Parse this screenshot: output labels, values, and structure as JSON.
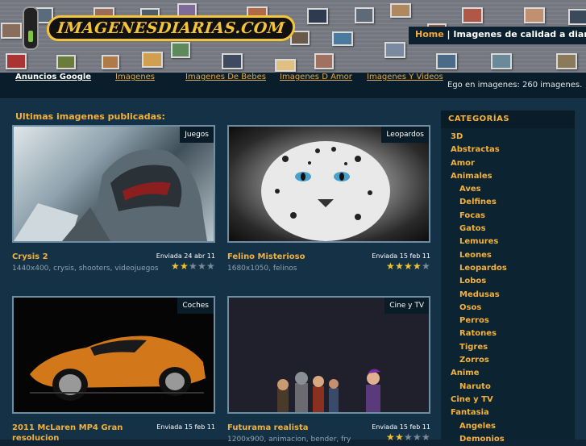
{
  "header": {
    "logo_text": "IMAGENESDIARIAS.COM",
    "nav_home": "Home",
    "nav_sep": " | ",
    "nav_tagline": "Imagenes de calidad a diario"
  },
  "navbar": {
    "links": [
      "Anuncios Google",
      "Imagenes",
      "Imagenes De Bebes",
      "Imagenes D Amor",
      "Imagenes Y Videos"
    ],
    "count_text": "Ego en imagenes: 260 imagenes."
  },
  "main": {
    "latest_title": "Ultimas imagenes publicadas:",
    "cards": [
      {
        "badge": "Juegos",
        "title": "Crysis 2",
        "date": "Enviada 24 abr 11",
        "meta": "1440x400, crysis, shooters, videojuegos",
        "rating": 2
      },
      {
        "badge": "Leopardos",
        "title": "Felino Misterioso",
        "date": "Enviada 15 feb 11",
        "meta": "1680x1050, felinos",
        "rating": 4
      },
      {
        "badge": "Coches",
        "title": "2011 McLaren MP4 Gran resolucion",
        "date": "Enviada 15 feb 11",
        "meta": "",
        "rating": 0
      },
      {
        "badge": "Cine y TV",
        "title": "Futurama realista",
        "date": "Enviada 15 feb 11",
        "meta": "1200x900, animacion, bender, fry",
        "rating": 2
      }
    ]
  },
  "sidebar": {
    "title": "CATEGORÍAS",
    "categories": [
      {
        "label": "3D",
        "level": "top"
      },
      {
        "label": "Abstractas",
        "level": "top"
      },
      {
        "label": "Amor",
        "level": "top"
      },
      {
        "label": "Animales",
        "level": "top"
      },
      {
        "label": "Aves",
        "level": "sub"
      },
      {
        "label": "Delfines",
        "level": "sub"
      },
      {
        "label": "Focas",
        "level": "sub"
      },
      {
        "label": "Gatos",
        "level": "sub"
      },
      {
        "label": "Lemures",
        "level": "sub"
      },
      {
        "label": "Leones",
        "level": "sub"
      },
      {
        "label": "Leopardos",
        "level": "sub"
      },
      {
        "label": "Lobos",
        "level": "sub"
      },
      {
        "label": "Medusas",
        "level": "sub"
      },
      {
        "label": "Osos",
        "level": "sub"
      },
      {
        "label": "Perros",
        "level": "sub"
      },
      {
        "label": "Ratones",
        "level": "sub"
      },
      {
        "label": "Tigres",
        "level": "sub"
      },
      {
        "label": "Zorros",
        "level": "sub"
      },
      {
        "label": "Anime",
        "level": "top"
      },
      {
        "label": "Naruto",
        "level": "sub"
      },
      {
        "label": "Cine y TV",
        "level": "top"
      },
      {
        "label": "Fantasia",
        "level": "top"
      },
      {
        "label": "Angeles",
        "level": "sub"
      },
      {
        "label": "Demonios",
        "level": "sub"
      }
    ]
  },
  "colors": {
    "accent": "#f4b13a",
    "background": "#143146",
    "navbar": "#0a1d2a"
  }
}
